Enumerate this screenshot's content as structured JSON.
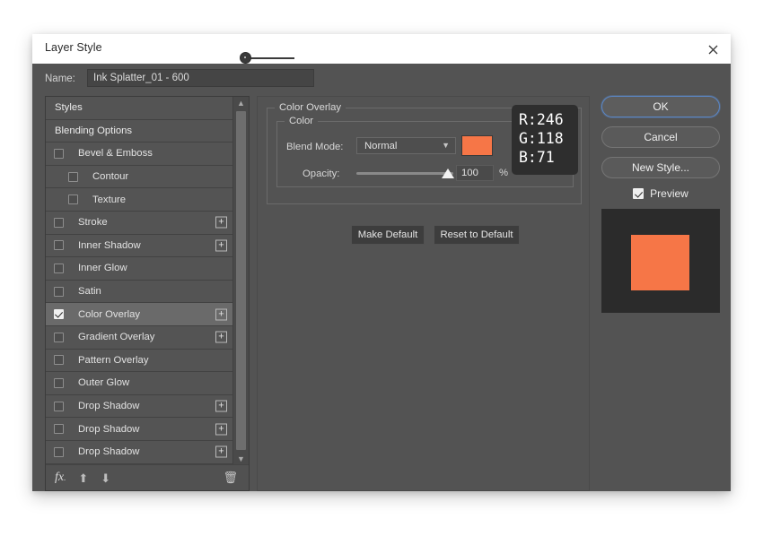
{
  "window": {
    "title": "Layer Style",
    "close_icon": "close-icon"
  },
  "name_field": {
    "label": "Name:",
    "value": "Ink Splatter_01 - 600"
  },
  "styles_list": {
    "items": [
      {
        "label": "Styles",
        "type": "header",
        "checkbox": null,
        "indent": 0,
        "has_plus": false,
        "selected": false
      },
      {
        "label": "Blending Options",
        "type": "header",
        "checkbox": null,
        "indent": 0,
        "has_plus": false,
        "selected": false
      },
      {
        "label": "Bevel & Emboss",
        "type": "effect",
        "checkbox": false,
        "indent": 0,
        "has_plus": false,
        "selected": false
      },
      {
        "label": "Contour",
        "type": "effect",
        "checkbox": false,
        "indent": 1,
        "has_plus": false,
        "selected": false
      },
      {
        "label": "Texture",
        "type": "effect",
        "checkbox": false,
        "indent": 1,
        "has_plus": false,
        "selected": false
      },
      {
        "label": "Stroke",
        "type": "effect",
        "checkbox": false,
        "indent": 0,
        "has_plus": true,
        "selected": false
      },
      {
        "label": "Inner Shadow",
        "type": "effect",
        "checkbox": false,
        "indent": 0,
        "has_plus": true,
        "selected": false
      },
      {
        "label": "Inner Glow",
        "type": "effect",
        "checkbox": false,
        "indent": 0,
        "has_plus": false,
        "selected": false
      },
      {
        "label": "Satin",
        "type": "effect",
        "checkbox": false,
        "indent": 0,
        "has_plus": false,
        "selected": false
      },
      {
        "label": "Color Overlay",
        "type": "effect",
        "checkbox": true,
        "indent": 0,
        "has_plus": true,
        "selected": true
      },
      {
        "label": "Gradient Overlay",
        "type": "effect",
        "checkbox": false,
        "indent": 0,
        "has_plus": true,
        "selected": false
      },
      {
        "label": "Pattern Overlay",
        "type": "effect",
        "checkbox": false,
        "indent": 0,
        "has_plus": false,
        "selected": false
      },
      {
        "label": "Outer Glow",
        "type": "effect",
        "checkbox": false,
        "indent": 0,
        "has_plus": false,
        "selected": false
      },
      {
        "label": "Drop Shadow",
        "type": "effect",
        "checkbox": false,
        "indent": 0,
        "has_plus": true,
        "selected": false
      },
      {
        "label": "Drop Shadow",
        "type": "effect",
        "checkbox": false,
        "indent": 0,
        "has_plus": true,
        "selected": false
      },
      {
        "label": "Drop Shadow",
        "type": "effect",
        "checkbox": false,
        "indent": 0,
        "has_plus": true,
        "selected": false
      }
    ],
    "footer": {
      "fx_icon": "fx-icon",
      "move_up_icon": "arrow-up-icon",
      "move_down_icon": "arrow-down-icon",
      "delete_icon": "trash-icon"
    },
    "scrollbar": {
      "up_arrow_icon": "chevron-up-icon",
      "down_arrow_icon": "chevron-down-icon"
    }
  },
  "color_overlay": {
    "group_title": "Color Overlay",
    "inner_group_title": "Color",
    "blend_mode_label": "Blend Mode:",
    "blend_mode_value": "Normal",
    "blend_mode_chevron_icon": "chevron-down-icon",
    "swatch_color": "#F67647",
    "opacity_label": "Opacity:",
    "opacity_value": "100",
    "opacity_unit": "%",
    "make_default_label": "Make Default",
    "reset_default_label": "Reset to Default"
  },
  "rgb_tooltip": {
    "r": "R:246",
    "g": "G:118",
    "b": "B:71"
  },
  "right_panel": {
    "ok_label": "OK",
    "cancel_label": "Cancel",
    "new_style_label": "New Style...",
    "preview_label": "Preview",
    "preview_checked": true,
    "preview_swatch_color": "#F67647",
    "preview_bg_color": "#2B2B2B"
  }
}
